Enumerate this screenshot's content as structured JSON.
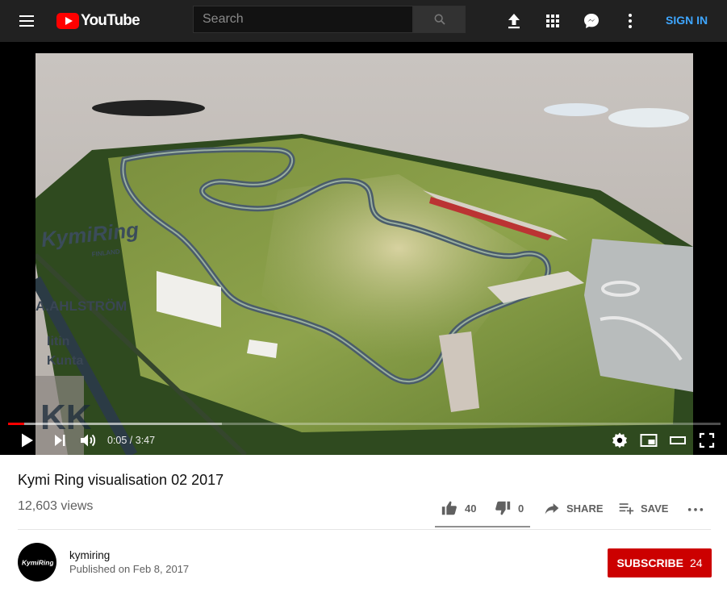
{
  "header": {
    "logo_text": "YouTube",
    "search_placeholder": "Search",
    "sign_in_label": "SIGN IN",
    "icons": [
      "menu-icon",
      "search-icon",
      "upload-icon",
      "apps-icon",
      "messages-icon",
      "more-vertical-icon"
    ]
  },
  "player": {
    "watermark_brand": "KymiRing",
    "watermark_sub": "FINLAND",
    "sponsor_1": "A.AHLSTRÖM",
    "sponsor_2_line1": "Iitin",
    "sponsor_2_line2": "Kunta",
    "time_display": "0:05 / 3:47",
    "progress_fraction": 0.023,
    "buffered_fraction": 0.3,
    "controls": [
      "play-icon",
      "next-icon",
      "volume-icon",
      "settings-icon",
      "miniplayer-icon",
      "theater-icon",
      "fullscreen-icon"
    ]
  },
  "video": {
    "title": "Kymi Ring visualisation 02 2017",
    "views": "12,603 views",
    "likes": "40",
    "dislikes": "0",
    "share_label": "SHARE",
    "save_label": "SAVE"
  },
  "channel": {
    "name": "kymiring",
    "published": "Published on Feb 8, 2017",
    "avatar_text": "KymiRing",
    "subscribe_label": "SUBSCRIBE",
    "subscriber_count": "24"
  },
  "colors": {
    "header_bg": "#212121",
    "accent_red": "#ff0000",
    "subscribe_red": "#cc0000",
    "link_blue": "#3ea6ff"
  }
}
